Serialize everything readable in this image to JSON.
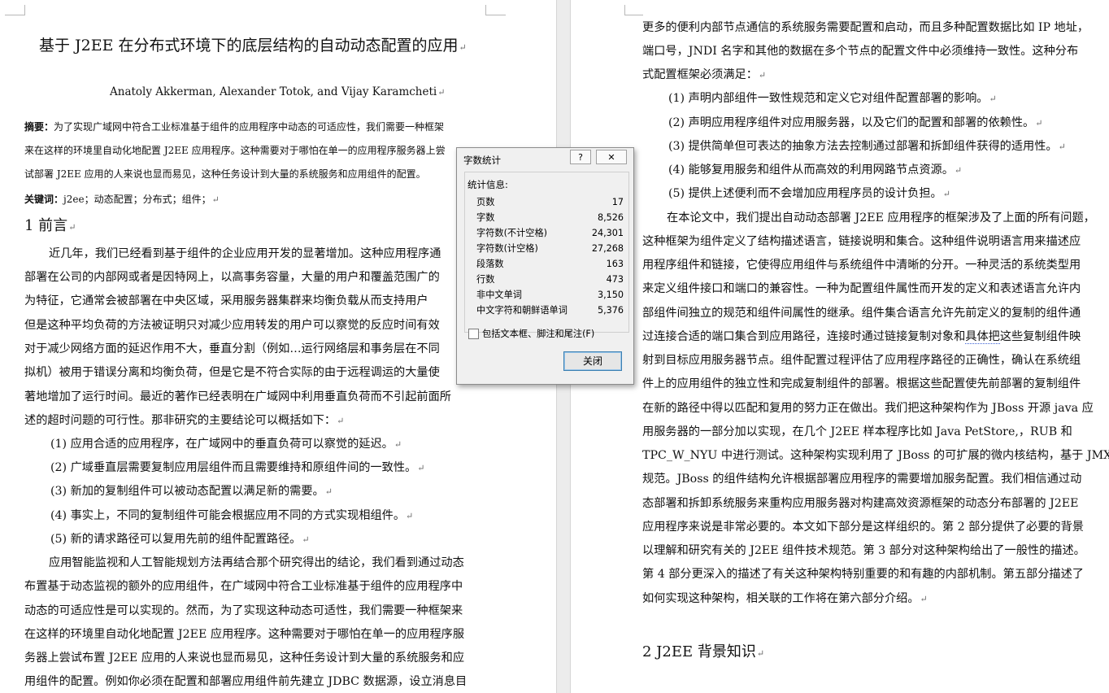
{
  "left_page": {
    "title": "基于 J2EE 在分布式环境下的底层结构的自动动态配置的应用",
    "authors": "Anatoly Akkerman, Alexander Totok, and Vijay Karamcheti",
    "abstract_label": "摘要：",
    "abstract_lines": [
      "为了实现广域网中符合工业标准基于组件的应用程序中动态的可适应性，我们需要一种框架",
      "来在这样的环境里自动化地配置 J2EE 应用程序。这种需要对于哪怕在单一的应用程序服务器上尝",
      "试部署 J2EE 应用的人来说也显而易见，这种任务设计到大量的系统服务和应用组件的配置。"
    ],
    "keywords_label": "关键词：",
    "keywords": "j2ee；动态配置；分布式；组件；",
    "section1": "1  前言",
    "body_lines": [
      "近几年，我们已经看到基于组件的企业应用开发的显著增加。这种应用程序通",
      "部署在公司的内部网或者是因特网上，以高事务容量，大量的用户和覆盖范围广的",
      "为特征，它通常会被部署在中央区域，采用服务器集群来均衡负载从而支持用户",
      "但是这种平均负荷的方法被证明只对减少应用转发的用户可以察觉的反应时间有效",
      "对于减少网络方面的延迟作用不大，垂直分割（例如…运行网络层和事务层在不同",
      "拟机）被用于错误分离和均衡负荷，但是它是不符合实际的由于远程调运的大量使",
      "著地增加了运行时间。最近的著作已经表明在广域网中利用垂直负荷而不引起前面所",
      "述的超时问题的可行性。那非研究的主要结论可以概括如下："
    ],
    "list_items": [
      "(1)  应用合适的应用程序，在广域网中的垂直负荷可以察觉的延迟。",
      "(2)  广域垂直层需要复制应用层组件而且需要维持和原组件间的一致性。",
      "(3)  新加的复制组件可以被动态配置以满足新的需要。",
      "(4)  事实上，不同的复制组件可能会根据应用不同的方式实现相组件。",
      "(5)  新的请求路径可以复用先前的组件配置路径。"
    ],
    "body2_lines": [
      "应用智能监视和人工智能规划方法再结合那个研究得出的结论，我们看到通过动态",
      "布置基于动态监视的额外的应用组件，在广域网中符合工业标准基于组件的应用程序中",
      "动态的可适应性是可以实现的。然而，为了实现这种动态可适性，我们需要一种框架来",
      "在这样的环境里自动化地配置 J2EE 应用程序。这种需要对于哪怕在单一的应用程序服",
      "务器上尝试布置 J2EE 应用的人来说也显而易见，这种任务设计到大量的系统服务和应",
      "用组件的配置。例如你必须在配置和部署应用组件前先建立 JDBC 数据源，设立消息目"
    ]
  },
  "right_page": {
    "intro_lines": [
      "更多的便利内部节点通信的系统服务需要配置和启动，而且多种配置数据比如 IP 地址，",
      "端口号，JNDI 名字和其他的数据在多个节点的配置文件中必须维持一致性。这种分布",
      "式配置框架必须满足："
    ],
    "list_items": [
      "(1)  声明内部组件一致性规范和定义它对组件配置部署的影响。",
      "(2)  声明应用程序组件对应用服务器，以及它们的配置和部署的依赖性。",
      "(3)  提供简单但可表达的抽象方法去控制通过部署和拆卸组件获得的适用性。",
      "(4)  能够复用服务和组件从而高效的利用网路节点资源。",
      "(5)  提供上述便利而不会增加应用程序员的设计负担。"
    ],
    "body_lines": [
      "在本论文中，我们提出自动动态部署 J2EE 应用程序的框架涉及了上面的所有问题，",
      "这种框架为组件定义了结构描述语言，链接说明和集合。这种组件说明语言用来描述应",
      "用程序组件和链接，它使得应用组件与系统组件中清晰的分开。一种灵活的系统类型用",
      "来定义组件接口和端口的兼容性。一种为配置组件属性而开发的定义和表述语言允许内",
      "部组件间独立的规范和组件间属性的继承。组件集合语言允许先前定义的复制的组件通",
      "过连接合适的端口集合到应用路径，连接时通过链接复制对象和",
      "射到目标应用服务器节点。组件配置过程评估了应用程序路径的正确性，确认在系统组",
      "件上的应用组件的独立性和完成复制组件的部署。根据这些配置使先前部署的复制组件",
      "在新的路径中得以匹配和复用的努力正在做出。我们把这种架构作为 JBoss 开源 java 应",
      "用服务器的一部分加以实现，在几个 J2EE 样本程序比如 Java PetStore,，RUB 和",
      "TPC_W_NYU 中进行测试。这种架构实现利用了 JBoss 的可扩展的微内核结构，基于 JMX",
      "规范。JBoss 的组件结构允许根据部署应用程序的需要增加服务配置。我们相信通过动",
      "态部署和拆卸系统服务来重构应用服务器对构建高效资源框架的动态分布部署的 J2EE",
      "应用程序来说是非常必要的。本文如下部分是这样组织的。第 2 部分提供了必要的背景",
      "以理解和研究有关的 J2EE 组件技术规范。第 3 部分对这种架构给出了一般性的描述。",
      "第 4 部分更深入的描述了有关这种架构特别重要的和有趣的内部机制。第五部分描述了",
      "如何实现这种架构，相关联的工作将在第六部分介绍。"
    ],
    "squiggle_word": "具体把",
    "squiggle_tail": "这些复制组件映",
    "section2": "2    J2EE 背景知识"
  },
  "dialog": {
    "title": "字数统计",
    "help": "?",
    "close_x": "✕",
    "group_label": "统计信息:",
    "stats": [
      {
        "label": "页数",
        "value": "17"
      },
      {
        "label": "字数",
        "value": "8,526"
      },
      {
        "label": "字符数(不计空格)",
        "value": "24,301"
      },
      {
        "label": "字符数(计空格)",
        "value": "27,268"
      },
      {
        "label": "段落数",
        "value": "163"
      },
      {
        "label": "行数",
        "value": "473"
      },
      {
        "label": "非中文单词",
        "value": "3,150"
      },
      {
        "label": "中文字符和朝鲜语单词",
        "value": "5,376"
      }
    ],
    "checkbox_label": "包括文本框、脚注和尾注(F)",
    "checkbox_checked": false,
    "close_button": "关闭"
  },
  "para_mark": "↵"
}
